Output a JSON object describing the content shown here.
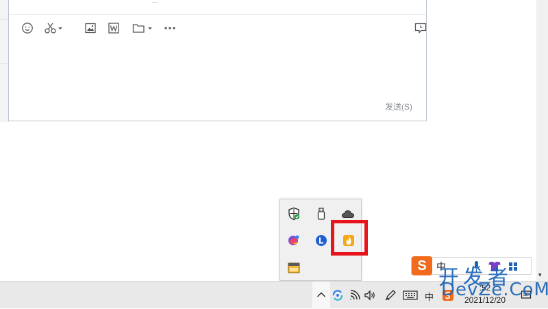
{
  "chat": {
    "send_label": "发送(S)",
    "toolbar_icons": [
      "emoji-icon",
      "scissors-icon",
      "image-icon",
      "word-icon",
      "folder-icon",
      "more-icon",
      "message-record-icon"
    ]
  },
  "tray_popup": {
    "icons": [
      "security-shield-icon",
      "usb-drive-icon",
      "onedrive-cloud-icon",
      "colorful-app-icon",
      "blue-l-app-icon",
      "orange-flame-app-icon",
      "window-app-icon"
    ],
    "highlighted": "orange-flame-app-icon",
    "highlight_color": "#e8141c"
  },
  "taskbar": {
    "ime_label": "中",
    "clock_time": "   :52",
    "clock_date": "2021/12/20"
  },
  "sogou_bar": {
    "logo": "S",
    "mode": "中"
  },
  "watermark": {
    "line1": "开发者",
    "line2": "DevZe.CoM"
  }
}
